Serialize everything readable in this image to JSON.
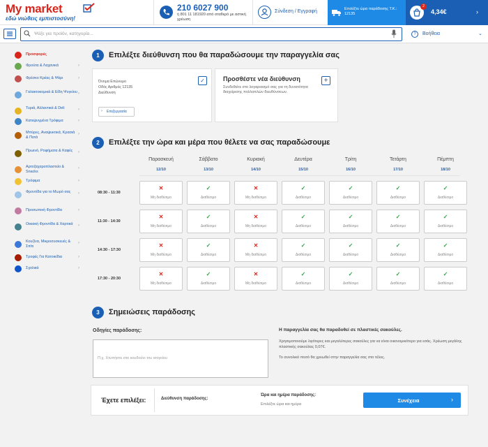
{
  "header": {
    "brand": "My market",
    "slogan": "εδώ νιώθεις εμπιστοσύνη!",
    "phone": "210 6027 900",
    "phone_note": "ή 801 11 181920 από σταθερό με αστική χρέωση",
    "login": "Σύνδεση / Εγγραφή",
    "delivery": "Επιλέξτε ώρα παράδοσης Τ.Κ.: 12135",
    "cart_count": "2",
    "cart_total": "4,34€"
  },
  "search": {
    "placeholder": "Ψάξε για προϊόν, κατηγορία...",
    "help": "Βοήθεια"
  },
  "sidebar": {
    "items": [
      {
        "label": "Προσφορές",
        "color": "#d9261c"
      },
      {
        "label": "Φρούτα & Λαχανικά",
        "color": "#6aa84f"
      },
      {
        "label": "Φρέσκο Κρέας & Ψάρι",
        "color": "#c0504d"
      },
      {
        "label": "Γαλακτοκομικά & Είδη Ψυγείου",
        "color": "#6fa8dc"
      },
      {
        "label": "Τυριά, Αλλαντικά & Deli",
        "color": "#e6b422"
      },
      {
        "label": "Κατεψυγμένα Τρόφιμα",
        "color": "#3d85c6"
      },
      {
        "label": "Μπύρες, Αναψυκτικά, Κρασιά & Ποτά",
        "color": "#b45f06"
      },
      {
        "label": "Πρωινό, Ροφήματα & Καφές",
        "color": "#7f6000"
      },
      {
        "label": "Αρτοζαχαροπλαστείο & Snacks",
        "color": "#e69138"
      },
      {
        "label": "Τρόφιμα",
        "color": "#f1c232"
      },
      {
        "label": "Φροντίδα για το Μωρό σας",
        "color": "#9fc5e8"
      },
      {
        "label": "Προσωπική Φροντίδα",
        "color": "#c27ba0"
      },
      {
        "label": "Οικιακή Φροντίδα & Χαρτικά",
        "color": "#45818e"
      },
      {
        "label": "Κουζίνα, Μικροσυσκευές & Σπίτι",
        "color": "#3c78d8"
      },
      {
        "label": "Τροφές Για Κατοικίδια",
        "color": "#a61c00"
      },
      {
        "label": "Σχολικά",
        "color": "#1155cc"
      }
    ]
  },
  "step1": {
    "num": "1",
    "title": "Επιλέξτε διεύθυνση που θα παραδώσουμε την παραγγελία σας",
    "address": {
      "line1": "Όνομα Επώνυμο",
      "line2": "Οδός Αριθμός 12135",
      "line3": "Διεύθυνση",
      "edit": "Επεξεργασία"
    },
    "add": {
      "title": "Προσθέστε νέα διεύθυνση",
      "text": "Συνδεθείτε στο λογαριασμό σας για τη δυνατότητα διαχείρισης πολλαπλών διευθύνσεων."
    }
  },
  "step2": {
    "num": "2",
    "title": "Επιλέξτε την ώρα και μέρα που θέλετε να σας παραδώσουμε",
    "days": [
      {
        "name": "Παρασκευή",
        "date": "12/10"
      },
      {
        "name": "Σάββατο",
        "date": "13/10"
      },
      {
        "name": "Κυριακή",
        "date": "14/10"
      },
      {
        "name": "Δευτέρα",
        "date": "15/10"
      },
      {
        "name": "Τρίτη",
        "date": "16/10"
      },
      {
        "name": "Τετάρτη",
        "date": "17/10"
      },
      {
        "name": "Πέμπτη",
        "date": "18/10"
      }
    ],
    "times": [
      "08:30 - 11:30",
      "11:30 - 14:30",
      "14:30 - 17:30",
      "17:30 - 20:30"
    ],
    "available_label": "Διαθέσιμο",
    "unavailable_label": "Μη διαθέσιμο",
    "availability": [
      [
        false,
        true,
        false,
        true,
        true,
        true,
        true
      ],
      [
        false,
        true,
        false,
        true,
        true,
        true,
        true
      ],
      [
        false,
        true,
        false,
        true,
        true,
        true,
        true
      ],
      [
        false,
        true,
        false,
        true,
        true,
        true,
        true
      ]
    ]
  },
  "step3": {
    "num": "3",
    "title": "Σημειώσεις παράδοσης",
    "notes_label": "Οδηγίες παράδοσης:",
    "notes_placeholder": "Π.χ. Χτυπήστε στο κουδούνι του ισογείου",
    "bag_title": "Η παραγγελία σας θα παραδοθεί σε πλαστικές σακούλες.",
    "bag_text": "Χρησιμοποιούμε λιγότερες και μεγαλύτερες σακούλες για να είναι οικονομικότερο για εσάς. Χρέωση μεγάλης πλαστικής σακούλας 0,07€.",
    "bag_text2": "Το συνολικό ποσό θα χρεωθεί στην παραγγελία σας στο τέλος."
  },
  "summary": {
    "chosen": "Έχετε επιλέξει:",
    "address": "Διεύθυνση παράδοσης:",
    "when": "Ώρα και ημέρα παράδοσης:",
    "when_value": "Επιλέξτε ώρα και ημέρα",
    "continue": "Συνέχεια"
  }
}
